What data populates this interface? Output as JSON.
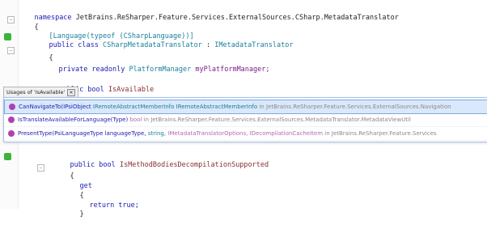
{
  "code": {
    "namespace_kw": "namespace",
    "namespace_name": "JetBrains.ReSharper.Feature.Services.ExternalSources.CSharp.MetadataTranslator",
    "brace_open": "{",
    "attribute": "[Language(typeof (CSharpLanguage))]",
    "class_decl_kw": "public class",
    "class_name": "CSharpMetadataTranslator",
    "class_colon": ":",
    "class_iface": "IMetadataTranslator",
    "class_brace": "{",
    "field_kw": "private readonly",
    "field_type": "PlatformManager",
    "field_name": "myPlatformManager;",
    "prop_kw": "public bool",
    "prop_name": "IsAvailable",
    "lower_method_kw": "public bool",
    "lower_method_name": "IsMethodBodiesDecompilationSupported",
    "lower_brace": "{",
    "get_kw": "get",
    "get_brace": "{",
    "return_stmt": "return true;",
    "close_brace": "}"
  },
  "popup": {
    "header": "Usages of 'IsAvailable'",
    "close_label": "×",
    "rows": [
      {
        "method": "CanNavigateTo(IPsiObject ",
        "sig_mid": "IRemoteAbstractMemberInfo ",
        "sig_rest": "IRemoteAbstractMemberInfo ",
        "loc": "in JetBrains.ReSharper.Feature.Services.ExternalSources.Navigation"
      },
      {
        "method": "IsTranslateAvailableForLanguage(Type) ",
        "sig_mid": "bool",
        "sig_rest": "",
        "loc": "in JetBrains.ReSharper.Feature.Services.ExternalSources.MetadataTranslator.MetadataViewUtil"
      },
      {
        "method": "PresentType(PsiLanguageType languageType, ",
        "sig_mid": "string, ",
        "sig_rest": "IMetadataTranslatorOptions, IDecompilationCacheItem",
        "loc": "in JetBrains.ReSharper.Feature.Services"
      }
    ]
  },
  "colors": {
    "keyword": "#1c1cb4",
    "type": "#1a7f9a",
    "field": "#7a1f8a",
    "selection": "#d9e8fb",
    "gutter_icon": "#3cb43c"
  },
  "icons": [
    "fold-toggle-icon",
    "implements-icon",
    "method-icon",
    "close-icon"
  ]
}
